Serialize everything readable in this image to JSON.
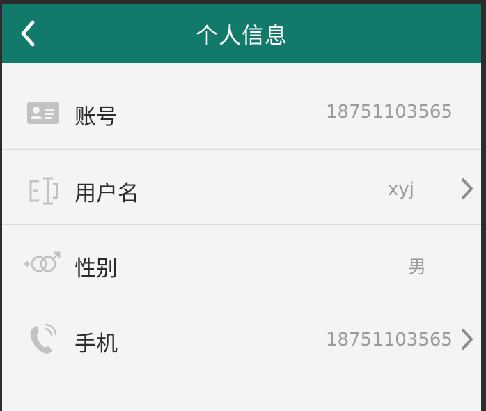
{
  "header": {
    "title": "个人信息",
    "back_icon": "chevron-left-icon"
  },
  "rows": [
    {
      "label": "账号",
      "value": "18751103565",
      "icon": "id-card-icon",
      "has_chevron": false
    },
    {
      "label": "用户名",
      "value": "xyj",
      "icon": "text-cursor-icon",
      "has_chevron": true
    },
    {
      "label": "性别",
      "value": "男",
      "icon": "gender-icon",
      "has_chevron": false
    },
    {
      "label": "手机",
      "value": "18751103565",
      "icon": "phone-icon",
      "has_chevron": true
    }
  ],
  "colors": {
    "topbar": "#117a6b",
    "background": "#f4f4f4",
    "icon_gray": "#c2c2c2",
    "value_gray": "#9b9b9b"
  }
}
